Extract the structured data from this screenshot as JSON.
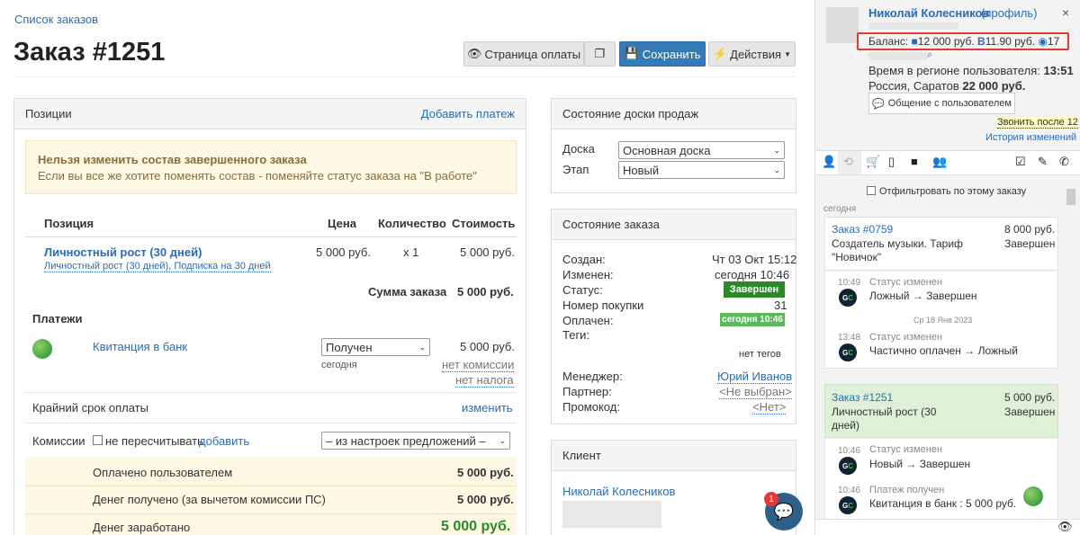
{
  "breadcrumb": "Список заказов",
  "title": "Заказ #1251",
  "toolbar": {
    "pay_page": "Страница оплаты",
    "save": "Сохранить",
    "actions": "Действия"
  },
  "positions": {
    "header": "Позиции",
    "add_payment": "Добавить платеж",
    "warning_title": "Нельзя изменить состав завершенного заказа",
    "warning_text": "Если вы все же хотите поменять состав - поменяйте статус заказа на \"В работе\"",
    "cols": {
      "position": "Позиция",
      "price": "Цена",
      "qty": "Количество",
      "cost": "Стоимость"
    },
    "item": {
      "name": "Личностный рост (30 дней)",
      "sub": "Личностный рост (30 дней), Подписка на 30 дней",
      "price": "5 000 руб.",
      "qty": "x 1",
      "cost": "5 000 руб."
    },
    "sum_label": "Сумма заказа",
    "sum_value": "5 000 руб.",
    "payments_header": "Платежи",
    "payment": {
      "name": "Квитанция в банк",
      "status": "Получен",
      "date": "сегодня",
      "amount": "5 000 руб.",
      "no_commission": "нет комиссии",
      "no_tax": "нет налога"
    },
    "deadline_label": "Крайний срок оплаты",
    "deadline_action": "изменить",
    "commissions_label": "Комиссии",
    "no_recalc": "не пересчитывать",
    "add": "добавить",
    "commission_select": "– из настроек предложений –",
    "totals": [
      {
        "label": "Оплачено пользователем",
        "value": "5 000 руб."
      },
      {
        "label": "Денег получено (за вычетом комиссии ПС)",
        "value": "5 000 руб."
      },
      {
        "label": "Денег заработано",
        "value": "5 000 руб."
      }
    ]
  },
  "sales_board": {
    "header": "Состояние доски продаж",
    "board_label": "Доска",
    "board_value": "Основная доска",
    "stage_label": "Этап",
    "stage_value": "Новый"
  },
  "order_state": {
    "header": "Состояние заказа",
    "created_label": "Создан:",
    "created_value": "Чт 03 Окт 15:12",
    "changed_label": "Изменен:",
    "changed_value": "сегодня 10:46",
    "status_label": "Статус:",
    "status_value": "Завершен",
    "purchase_label": "Номер покупки",
    "purchase_value": "31",
    "paid_label": "Оплачен:",
    "paid_value": "сегодня 10:46",
    "tags_label": "Теги:",
    "tags_value": "нет тегов",
    "manager_label": "Менеджер:",
    "manager_value": "Юрий Иванов",
    "partner_label": "Партнер:",
    "partner_value": "<Не выбран>",
    "promo_label": "Промокод:",
    "promo_value": "<Нет>"
  },
  "client": {
    "header": "Клиент",
    "name": "Николай Колесников"
  },
  "chat_badge": "1",
  "profile": {
    "name": "Николай Колесников",
    "profile_link": "(профиль)",
    "balance_label": "Баланс:",
    "balance_rub": "12 000 руб.",
    "balance_b": "11.90 руб.",
    "balance_c": "17",
    "region_time_label": "Время в регионе пользователя:",
    "region_time": "13:51",
    "location": "Россия, Саратов",
    "location_amount": "22 000 руб.",
    "chat_button": "Общение с пользователем",
    "call_after": "Звонить после 12",
    "history": "История изменений",
    "filter": "Отфильтровать по этому заказу",
    "today": "сегодня"
  },
  "feed": [
    {
      "title": "Заказ #0759",
      "amount": "8 000 руб.",
      "desc": "Создатель музыки. Тариф \"Новичок\"",
      "status": "Завершен"
    },
    {
      "time": "10:49",
      "head": "Статус изменен",
      "text": "Ложный → Завершен"
    },
    {
      "date": "Ср 18 Янв 2023"
    },
    {
      "time": "13:48",
      "head": "Статус изменен",
      "text": "Частично оплачен → Ложный"
    },
    {
      "title": "Заказ #1251",
      "amount": "5 000 руб.",
      "desc": "Личностный рост (30 дней)",
      "status": "Завершен"
    },
    {
      "time": "10:46",
      "head": "Статус изменен",
      "text": "Новый → Завершен"
    },
    {
      "time": "10:46",
      "head": "Платеж получен",
      "text": "Квитанция в банк : 5 000 руб."
    }
  ],
  "colors": {
    "accent": "#337ab7",
    "status_green": "#2a8a2a",
    "warning_bg": "#fcf8e3",
    "highlight": "#e53935"
  }
}
